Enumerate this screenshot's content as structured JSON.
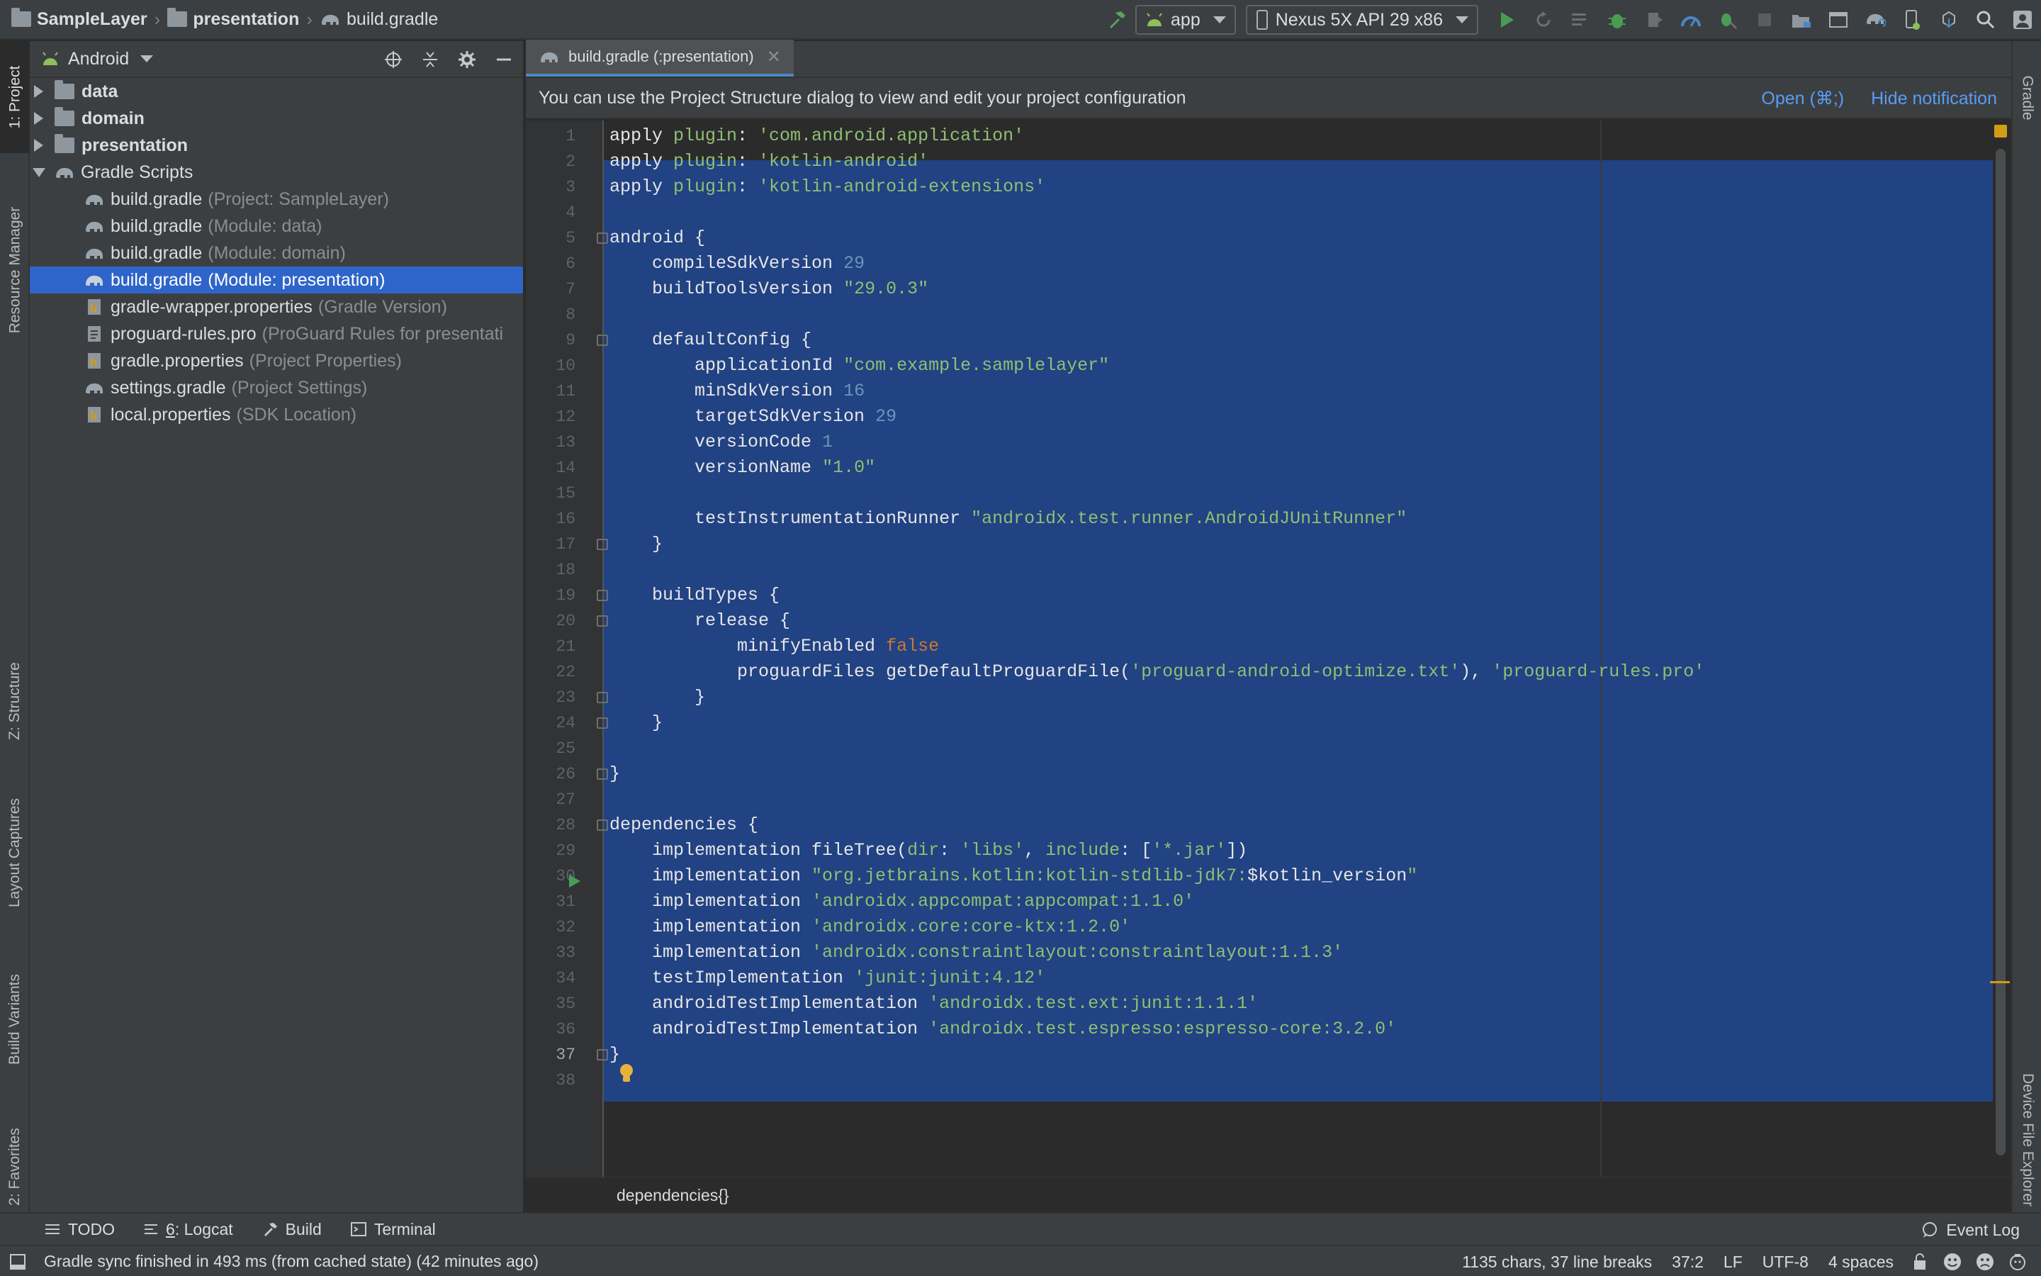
{
  "navbar": {
    "crumbs": [
      "SampleLayer",
      "presentation",
      "build.gradle"
    ],
    "run_config": "app",
    "device": "Nexus 5X API 29 x86"
  },
  "left_tabs": {
    "project": "1: Project",
    "resource_manager": "Resource Manager",
    "structure": "Z: Structure",
    "layout_captures": "Layout Captures",
    "build_variants": "Build Variants",
    "favorites": "2: Favorites"
  },
  "right_tabs": {
    "gradle": "Gradle",
    "device_file_explorer": "Device File Explorer"
  },
  "project_panel": {
    "view": "Android",
    "items": [
      {
        "name": "data",
        "hint": "",
        "level": 0,
        "expanded": false
      },
      {
        "name": "domain",
        "hint": "",
        "level": 0,
        "expanded": false
      },
      {
        "name": "presentation",
        "hint": "",
        "level": 0,
        "expanded": false
      },
      {
        "name": "Gradle Scripts",
        "hint": "",
        "level": 0,
        "expanded": true
      },
      {
        "name": "build.gradle",
        "hint": "(Project: SampleLayer)",
        "level": 1
      },
      {
        "name": "build.gradle",
        "hint": "(Module: data)",
        "level": 1
      },
      {
        "name": "build.gradle",
        "hint": "(Module: domain)",
        "level": 1
      },
      {
        "name": "build.gradle",
        "hint": "(Module: presentation)",
        "level": 1,
        "selected": true
      },
      {
        "name": "gradle-wrapper.properties",
        "hint": "(Gradle Version)",
        "level": 1
      },
      {
        "name": "proguard-rules.pro",
        "hint": "(ProGuard Rules for presentati",
        "level": 1
      },
      {
        "name": "gradle.properties",
        "hint": "(Project Properties)",
        "level": 1
      },
      {
        "name": "settings.gradle",
        "hint": "(Project Settings)",
        "level": 1
      },
      {
        "name": "local.properties",
        "hint": "(SDK Location)",
        "level": 1
      }
    ]
  },
  "editor": {
    "tab_label": "build.gradle (:presentation)",
    "notification": "You can use the Project Structure dialog to view and edit your project configuration",
    "notif_open": "Open (⌘;)",
    "notif_hide": "Hide notification",
    "line_numbers": [
      "1",
      "2",
      "3",
      "4",
      "5",
      "6",
      "7",
      "8",
      "9",
      "10",
      "11",
      "12",
      "13",
      "14",
      "15",
      "16",
      "17",
      "18",
      "19",
      "20",
      "21",
      "22",
      "23",
      "24",
      "25",
      "26",
      "27",
      "28",
      "29",
      "30",
      "31",
      "32",
      "33",
      "34",
      "35",
      "36",
      "37",
      "38"
    ],
    "code": [
      "apply plugin: 'com.android.application'",
      "apply plugin: 'kotlin-android'",
      "apply plugin: 'kotlin-android-extensions'",
      "",
      "android {",
      "    compileSdkVersion 29",
      "    buildToolsVersion \"29.0.3\"",
      "",
      "    defaultConfig {",
      "        applicationId \"com.example.samplelayer\"",
      "        minSdkVersion 16",
      "        targetSdkVersion 29",
      "        versionCode 1",
      "        versionName \"1.0\"",
      "",
      "        testInstrumentationRunner \"androidx.test.runner.AndroidJUnitRunner\"",
      "    }",
      "",
      "    buildTypes {",
      "        release {",
      "            minifyEnabled false",
      "            proguardFiles getDefaultProguardFile('proguard-android-optimize.txt'), 'proguard-rules.pro'",
      "        }",
      "    }",
      "",
      "}",
      "",
      "dependencies {",
      "    implementation fileTree(dir: 'libs', include: ['*.jar'])",
      "    implementation \"org.jetbrains.kotlin:kotlin-stdlib-jdk7:$kotlin_version\"",
      "    implementation 'androidx.appcompat:appcompat:1.1.0'",
      "    implementation 'androidx.core:core-ktx:1.2.0'",
      "    implementation 'androidx.constraintlayout:constraintlayout:1.1.3'",
      "    testImplementation 'junit:junit:4.12'",
      "    androidTestImplementation 'androidx.test.ext:junit:1.1.1'",
      "    androidTestImplementation 'androidx.test.espresso:espresso-core:3.2.0'",
      "}",
      ""
    ],
    "breadcrumb": "dependencies{}"
  },
  "bottom_tools": {
    "todo": "TODO",
    "logcat_num": "6",
    "logcat": ": Logcat",
    "build": "Build",
    "terminal": "Terminal",
    "event_log": "Event Log"
  },
  "status": {
    "message": "Gradle sync finished in 493 ms (from cached state) (42 minutes ago)",
    "chars": "1135 chars, 37 line breaks",
    "position": "37:2",
    "line_sep": "LF",
    "encoding": "UTF-8",
    "indent": "4 spaces"
  },
  "colors": {
    "selection": "#214283",
    "tree_selected": "#2f65ca",
    "string": "#8fbf73",
    "keyword": "#cc7832",
    "number": "#6897bb",
    "link": "#589df6",
    "run_green": "#499c54"
  }
}
